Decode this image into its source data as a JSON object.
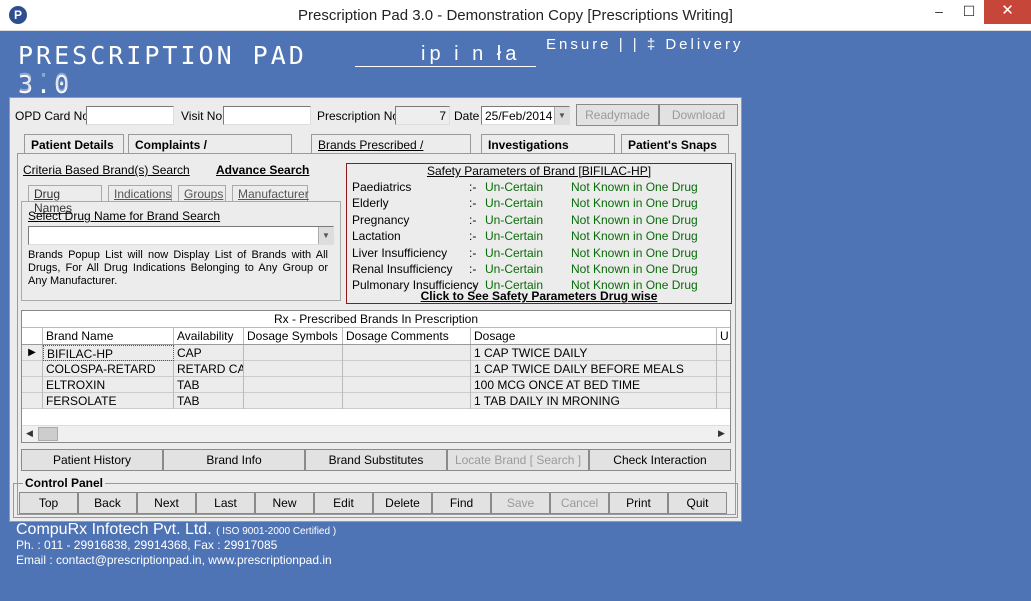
{
  "window": {
    "app_icon": "P",
    "title": "Prescription Pad 3.0 - Demonstration Copy   [Prescriptions Writing]",
    "minimize": "–",
    "maximize": "☐",
    "close": "✕"
  },
  "banner": {
    "title": "PRESCRIPTION PAD 3.0",
    "slogan_mid": "ip i n  ła",
    "slogan_right": "Ensure | | ‡ Delivery"
  },
  "header": {
    "opd_label": "OPD Card No",
    "opd_value": "",
    "visit_label": "Visit No",
    "visit_value": "",
    "prescription_label": "Prescription No",
    "prescription_value": "7",
    "date_label": "Date",
    "date_value": "25/Feb/2014",
    "readymade_button": "Readymade",
    "download_button": "Download"
  },
  "tabs": [
    {
      "label": "Patient Details"
    },
    {
      "label": "Complaints / Examinations"
    },
    {
      "label": "Brands Prescribed / Dosage"
    },
    {
      "label": "Investigations Details"
    },
    {
      "label": "Patient's Snaps"
    }
  ],
  "search": {
    "criteria_link": "Criteria Based Brand(s) Search",
    "advance_link": "Advance Search",
    "subtabs": [
      "Drug Names",
      "Indications",
      "Groups",
      "Manufacturer"
    ],
    "select_label": "Select Drug Name for Brand Search",
    "select_value": "",
    "info_text": "Brands Popup List will now Display List of Brands with All Drugs, For All Drug Indications Belonging to Any Group or Any Manufacturer."
  },
  "safety": {
    "caption": "Safety Parameters of Brand [BIFILAC-HP]",
    "rows": [
      {
        "param": "Paediatrics",
        "sep": ":-",
        "status": "Un-Certain",
        "note": "Not Known in One Drug"
      },
      {
        "param": "Elderly",
        "sep": ":-",
        "status": "Un-Certain",
        "note": "Not Known in One Drug"
      },
      {
        "param": "Pregnancy",
        "sep": ":-",
        "status": "Un-Certain",
        "note": "Not Known in One Drug"
      },
      {
        "param": "Lactation",
        "sep": ":-",
        "status": "Un-Certain",
        "note": "Not Known in One Drug"
      },
      {
        "param": "Liver Insufficiency",
        "sep": ":-",
        "status": "Un-Certain",
        "note": "Not Known in One Drug"
      },
      {
        "param": "Renal Insufficiency",
        "sep": ":-",
        "status": "Un-Certain",
        "note": "Not Known in One Drug"
      },
      {
        "param": "Pulmonary Insufficiency",
        "sep": ":-",
        "status": "Un-Certain",
        "note": "Not Known in One Drug"
      }
    ],
    "link": "Click to See Safety Parameters Drug wise"
  },
  "grid": {
    "title": "Rx - Prescribed Brands In Prescription",
    "columns": [
      "Brand Name",
      "Availability",
      "Dosage Symbols",
      "Dosage Comments",
      "Dosage",
      "U"
    ],
    "rows": [
      {
        "marker": "▶",
        "brand": "BIFILAC-HP",
        "availability": "CAP",
        "symbols": "",
        "comments": "",
        "dosage": "1 CAP TWICE DAILY"
      },
      {
        "marker": "",
        "brand": "COLOSPA-RETARD",
        "availability": "RETARD CA",
        "symbols": "",
        "comments": "",
        "dosage": "1 CAP TWICE DAILY BEFORE MEALS"
      },
      {
        "marker": "",
        "brand": "ELTROXIN",
        "availability": "TAB",
        "symbols": "",
        "comments": "",
        "dosage": "100 MCG ONCE AT BED TIME"
      },
      {
        "marker": "",
        "brand": "FERSOLATE",
        "availability": "TAB",
        "symbols": "",
        "comments": "",
        "dosage": "1 TAB DAILY IN MRONING"
      }
    ],
    "scroll_left": "◀",
    "scroll_right": "▶"
  },
  "actions": [
    "Patient History",
    "Brand Info",
    "Brand Substitutes",
    "Locate Brand  [ Search ]",
    "Check Interaction"
  ],
  "control_panel": {
    "caption": "Control Panel",
    "buttons": [
      "Top",
      "Back",
      "Next",
      "Last",
      "New",
      "Edit",
      "Delete",
      "Find",
      "Save",
      "Cancel",
      "Print",
      "Quit"
    ]
  },
  "footer": {
    "company": "CompuRx Infotech Pvt. Ltd.",
    "iso": "( ISO 9001-2000 Certified )",
    "phone": "Ph.       : 011 - 29916838, 29914368,  Fax : 29917085",
    "email": "Email    : contact@prescriptionpad.in, www.prescriptionpad.in"
  }
}
